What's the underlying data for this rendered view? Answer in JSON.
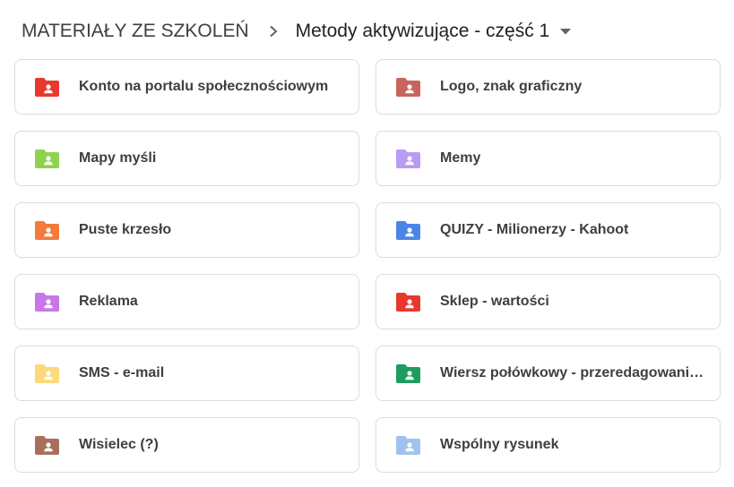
{
  "breadcrumb": {
    "root": "MATERIAŁY ZE SZKOLEŃ",
    "current": "Metody aktywizujące - część 1"
  },
  "folders": [
    {
      "label": "Konto na portalu społecznościowym",
      "color": "#e8382e",
      "icon": "shared-folder-icon"
    },
    {
      "label": "Logo, znak graficzny",
      "color": "#c9645c",
      "icon": "shared-folder-icon"
    },
    {
      "label": "Mapy myśli",
      "color": "#8dd34f",
      "icon": "shared-folder-icon"
    },
    {
      "label": "Memy",
      "color": "#b99af5",
      "icon": "shared-folder-icon"
    },
    {
      "label": "Puste krzesło",
      "color": "#f47a3c",
      "icon": "shared-folder-icon"
    },
    {
      "label": "QUIZY - Milionerzy - Kahoot",
      "color": "#4a86e8",
      "icon": "shared-folder-icon"
    },
    {
      "label": "Reklama",
      "color": "#c876e8",
      "icon": "shared-folder-icon"
    },
    {
      "label": "Sklep - wartości",
      "color": "#e8382e",
      "icon": "shared-folder-icon"
    },
    {
      "label": "SMS - e-mail",
      "color": "#fcd97a",
      "icon": "shared-folder-icon"
    },
    {
      "label": "Wiersz połówkowy - przeredagowanie ...",
      "color": "#1e9e5e",
      "icon": "shared-folder-icon"
    },
    {
      "label": "Wisielec (?)",
      "color": "#a8705c",
      "icon": "shared-folder-icon"
    },
    {
      "label": "Wspólny rysunek",
      "color": "#9fc3ec",
      "icon": "shared-folder-icon"
    }
  ]
}
